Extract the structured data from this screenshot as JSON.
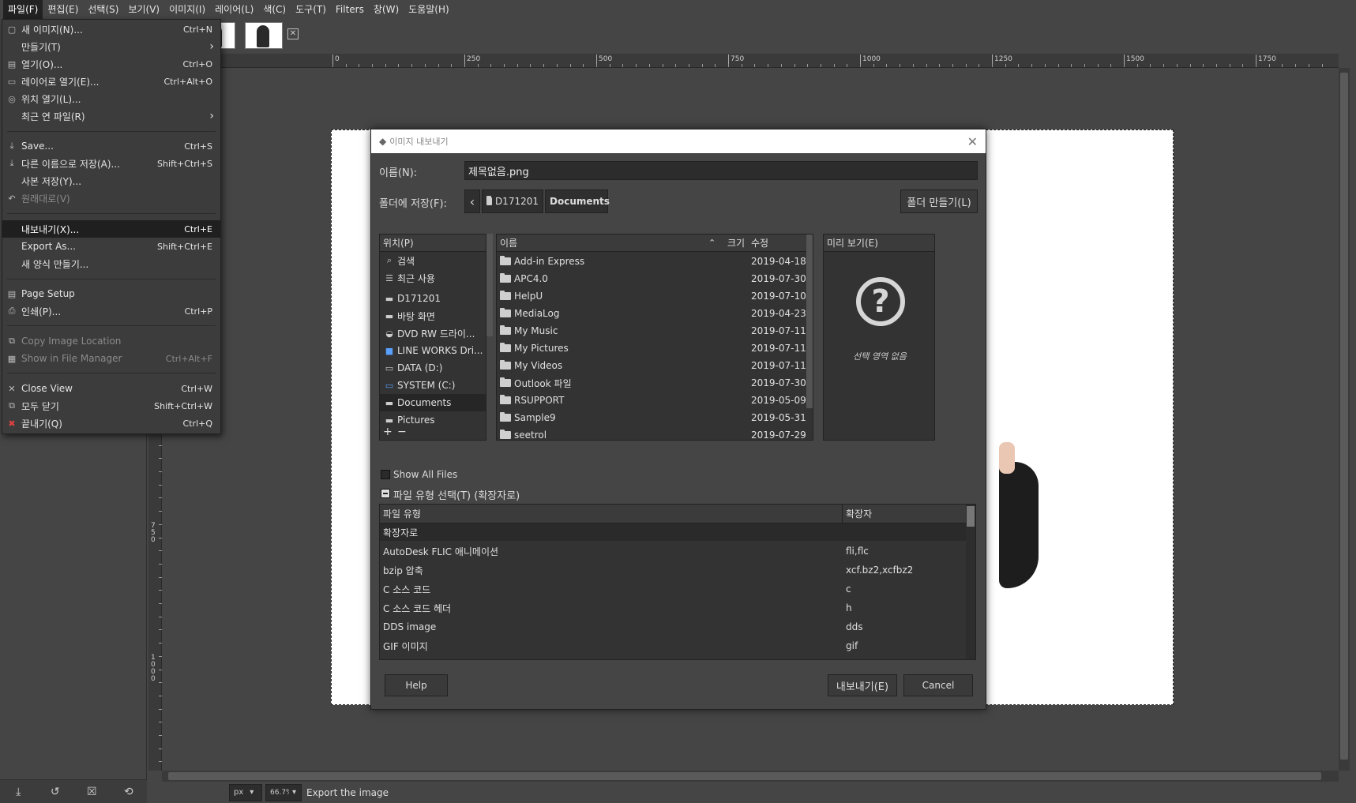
{
  "menubar": [
    "파일(F)",
    "편집(E)",
    "선택(S)",
    "보기(V)",
    "이미지(I)",
    "레이어(L)",
    "색(C)",
    "도구(T)",
    "Filters",
    "창(W)",
    "도움말(H)"
  ],
  "file_menu": {
    "items": [
      {
        "label": "새 이미지(N)...",
        "shortcut": "Ctrl+N",
        "icon": "new-image-icon"
      },
      {
        "label": "만들기(T)",
        "shortcut": "",
        "submenu": true
      },
      {
        "label": "열기(O)...",
        "shortcut": "Ctrl+O",
        "icon": "open-icon"
      },
      {
        "label": "레이어로 열기(E)...",
        "shortcut": "Ctrl+Alt+O",
        "icon": "open-as-layers-icon"
      },
      {
        "label": "위치 열기(L)...",
        "shortcut": "",
        "icon": "open-location-icon"
      },
      {
        "label": "최근 연 파일(R)",
        "shortcut": "",
        "submenu": true
      },
      {
        "label": "Save...",
        "shortcut": "Ctrl+S",
        "icon": "save-icon"
      },
      {
        "label": "다른 이름으로 저장(A)...",
        "shortcut": "Shift+Ctrl+S",
        "icon": "save-as-icon"
      },
      {
        "label": "사본 저장(Y)...",
        "shortcut": ""
      },
      {
        "label": "원래대로(V)",
        "shortcut": "",
        "icon": "revert-icon",
        "disabled": true
      },
      {
        "label": "내보내기(X)...",
        "shortcut": "Ctrl+E",
        "active": true
      },
      {
        "label": "Export As...",
        "shortcut": "Shift+Ctrl+E"
      },
      {
        "label": "새 양식 만들기...",
        "shortcut": ""
      },
      {
        "label": "Page Setup",
        "shortcut": "",
        "icon": "page-setup-icon"
      },
      {
        "label": "인쇄(P)...",
        "shortcut": "Ctrl+P",
        "icon": "print-icon"
      },
      {
        "label": "Copy Image Location",
        "shortcut": "",
        "icon": "copy-location-icon",
        "disabled": true
      },
      {
        "label": "Show in File Manager",
        "shortcut": "Ctrl+Alt+F",
        "icon": "file-manager-icon",
        "disabled": true
      },
      {
        "label": "Close View",
        "shortcut": "Ctrl+W",
        "icon": "close-view-icon"
      },
      {
        "label": "모두 닫기",
        "shortcut": "Shift+Ctrl+W",
        "icon": "close-all-icon"
      },
      {
        "label": "끝내기(Q)",
        "shortcut": "Ctrl+Q",
        "icon": "quit-icon"
      }
    ]
  },
  "ruler": {
    "h_labels": [
      "0",
      "250",
      "500",
      "750",
      "1000",
      "1250",
      "1500",
      "1750"
    ],
    "v_labels": [
      "750",
      "1000"
    ]
  },
  "dialog": {
    "title": "이미지 내보내기",
    "name_label": "이름(N):",
    "filename": "제목없음.png",
    "folder_label": "폴더에 저장(F):",
    "crumbs": [
      "D171201",
      "Documents"
    ],
    "create_folder": "폴더 만들기(L)",
    "places_header": "위치(P)",
    "places": [
      {
        "label": "검색",
        "icon": "search-icon"
      },
      {
        "label": "최근 사용",
        "icon": "recent-icon"
      },
      {
        "label": "D171201",
        "icon": "folder-icon"
      },
      {
        "label": "바탕 화면",
        "icon": "folder-icon"
      },
      {
        "label": "DVD RW 드라이...",
        "icon": "dvd-drive-icon"
      },
      {
        "label": "LINE WORKS Dri...",
        "icon": "cloud-drive-icon"
      },
      {
        "label": "DATA (D:)",
        "icon": "drive-icon"
      },
      {
        "label": "SYSTEM (C:)",
        "icon": "system-drive-icon"
      },
      {
        "label": "Documents",
        "icon": "folder-icon",
        "selected": true
      },
      {
        "label": "Pictures",
        "icon": "folder-icon"
      }
    ],
    "files_header": {
      "name": "이름",
      "size": "크기",
      "modified": "수정"
    },
    "files": [
      {
        "name": "Add-in Express",
        "date": "2019-04-18"
      },
      {
        "name": "APC4.0",
        "date": "2019-07-30"
      },
      {
        "name": "HelpU",
        "date": "2019-07-10"
      },
      {
        "name": "MediaLog",
        "date": "2019-04-23"
      },
      {
        "name": "My Music",
        "date": "2019-07-11"
      },
      {
        "name": "My Pictures",
        "date": "2019-07-11"
      },
      {
        "name": "My Videos",
        "date": "2019-07-11"
      },
      {
        "name": "Outlook 파일",
        "date": "2019-07-30"
      },
      {
        "name": "RSUPPORT",
        "date": "2019-05-09"
      },
      {
        "name": "Sample9",
        "date": "2019-05-31"
      },
      {
        "name": "seetrol",
        "date": "2019-07-29"
      }
    ],
    "preview_header": "미리 보기(E)",
    "no_selection": "선택 영역 없음",
    "show_all_files": "Show All Files",
    "filetype_toggle": "파일 유형 선택(T) (확장자로)",
    "filetype_header": {
      "type": "파일 유형",
      "ext": "확장자"
    },
    "filetypes": [
      {
        "type": "확장자로",
        "ext": ""
      },
      {
        "type": "AutoDesk FLIC 애니메이션",
        "ext": "fli,flc"
      },
      {
        "type": "bzip 압축",
        "ext": "xcf.bz2,xcfbz2"
      },
      {
        "type": "C 소스 코드",
        "ext": "c"
      },
      {
        "type": "C 소스 코드 헤더",
        "ext": "h"
      },
      {
        "type": "DDS image",
        "ext": "dds"
      },
      {
        "type": "GIF 이미지",
        "ext": "gif"
      }
    ],
    "help_button": "Help",
    "export_button": "내보내기(E)",
    "cancel_button": "Cancel"
  },
  "statusbar": {
    "unit": "px",
    "zoom": "66.7%",
    "message": "Export the image"
  }
}
